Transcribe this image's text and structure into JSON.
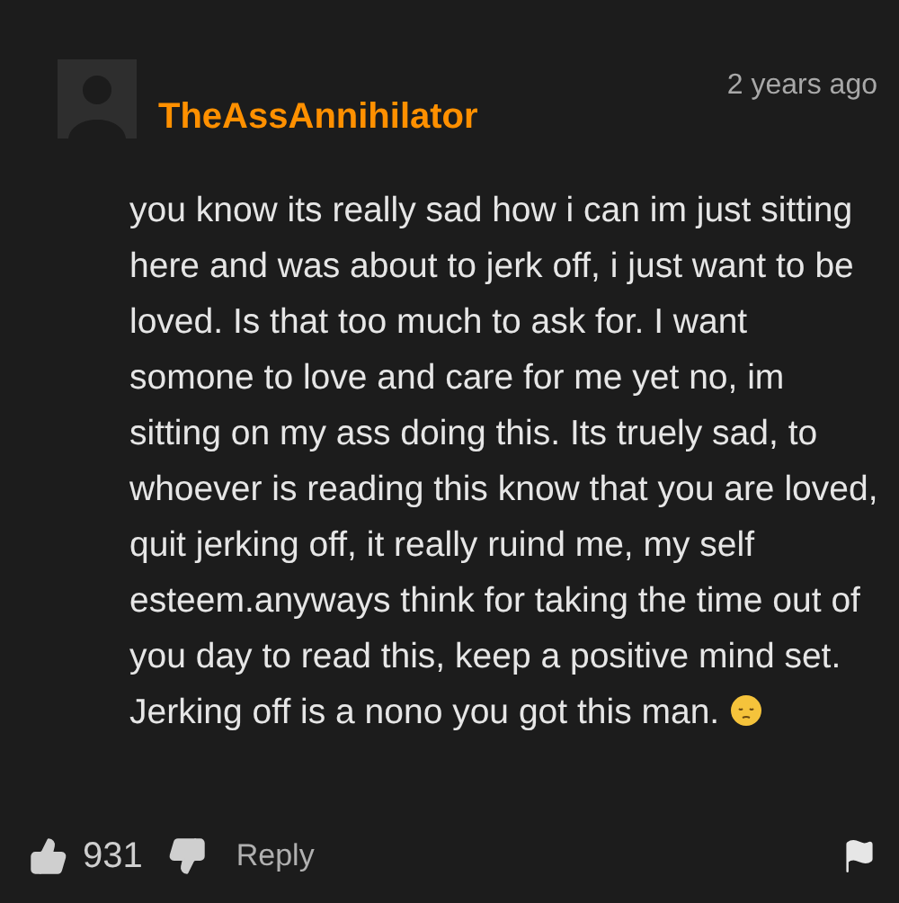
{
  "comment": {
    "username": "TheAssAnnihilator",
    "time": "2 years ago",
    "body": "you know its really sad how i can im just sitting here and was about to jerk off, i just want to be loved. Is that too much to ask for. I want somone to love and care for me yet no, im sitting on my ass doing this. Its truely sad, to whoever is reading this know that you are loved, quit jerking off, it really ruind me, my self esteem.anyways think for taking the time out of you day to read this, keep a positive mind set. Jerking off is a nono you got this man.",
    "likes": "931",
    "reply": "Reply"
  }
}
